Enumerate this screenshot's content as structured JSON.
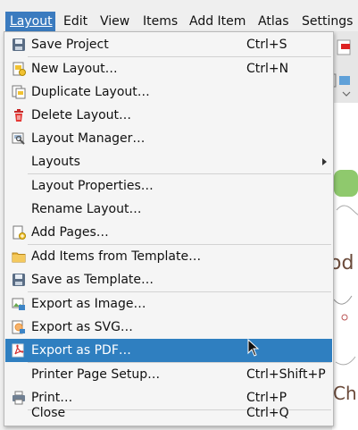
{
  "menubar": {
    "items": [
      {
        "label": "Layout",
        "mnemonic": "L"
      },
      {
        "label": "Edit",
        "mnemonic": "E"
      },
      {
        "label": "View",
        "mnemonic": "V"
      },
      {
        "label": "Items",
        "mnemonic": "I"
      },
      {
        "label": "Add Item",
        "mnemonic": "A"
      },
      {
        "label": "Atlas",
        "mnemonic": ""
      },
      {
        "label": "Settings",
        "mnemonic": ""
      }
    ],
    "active": "Layout"
  },
  "layout_menu": {
    "items": [
      {
        "label": "Save Project",
        "shortcut": "Ctrl+S",
        "icon": "save-icon"
      },
      {
        "label": "New Layout…",
        "shortcut": "Ctrl+N",
        "icon": "new-layout-icon"
      },
      {
        "label": "Duplicate Layout…",
        "shortcut": "",
        "icon": "duplicate-layout-icon"
      },
      {
        "label": "Delete Layout…",
        "shortcut": "",
        "icon": "trash-icon"
      },
      {
        "label": "Layout Manager…",
        "shortcut": "",
        "icon": "layout-manager-icon"
      },
      {
        "label": "Layouts",
        "shortcut": "",
        "icon": "",
        "submenu": true
      },
      {
        "label": "Layout Properties…",
        "shortcut": "",
        "icon": ""
      },
      {
        "label": "Rename Layout…",
        "shortcut": "",
        "icon": ""
      },
      {
        "label": "Add Pages…",
        "shortcut": "",
        "icon": "add-pages-icon"
      },
      {
        "label": "Add Items from Template…",
        "shortcut": "",
        "icon": "folder-icon"
      },
      {
        "label": "Save as Template…",
        "shortcut": "",
        "icon": "save-template-icon"
      },
      {
        "label": "Export as Image…",
        "shortcut": "",
        "icon": "export-image-icon"
      },
      {
        "label": "Export as SVG…",
        "shortcut": "",
        "icon": "export-svg-icon"
      },
      {
        "label": "Export as PDF…",
        "shortcut": "",
        "icon": "pdf-icon",
        "highlighted": true
      },
      {
        "label": "Printer Page Setup…",
        "shortcut": "Ctrl+Shift+P",
        "icon": ""
      },
      {
        "label": "Print…",
        "shortcut": "Ctrl+P",
        "icon": "printer-icon"
      },
      {
        "label": "Close",
        "shortcut": "Ctrl+Q",
        "icon": ""
      }
    ]
  },
  "background": {
    "canvas_text_1": "od",
    "canvas_text_2": "Ch"
  },
  "colors": {
    "highlight": "#2f7fc0",
    "menubar_active": "#3b7bbf",
    "menu_bg": "#f5f5f5"
  }
}
